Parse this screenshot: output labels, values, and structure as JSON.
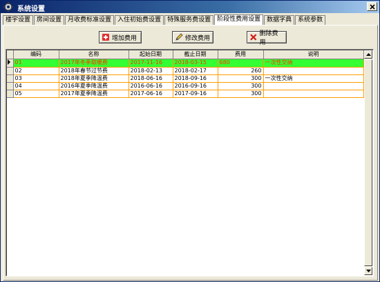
{
  "window": {
    "title": "系统设置"
  },
  "tabs": [
    {
      "label": "楼宇设置"
    },
    {
      "label": "房间设置"
    },
    {
      "label": "月收费标准设置"
    },
    {
      "label": "入住初始费设置"
    },
    {
      "label": "特殊服务费设置"
    },
    {
      "label": "阶段性费用设置"
    },
    {
      "label": "数据字典"
    },
    {
      "label": "系统参数"
    }
  ],
  "active_tab": "阶段性费用设置",
  "toolbar": {
    "add_label": "增加费用",
    "edit_label": "修改费用",
    "delete_label": "删除费用"
  },
  "table": {
    "columns": [
      "编码",
      "名称",
      "起始日期",
      "截止日期",
      "费用",
      "说明"
    ],
    "rows": [
      {
        "code": "01",
        "name": "2017年冬季取暖费",
        "start": "2017-11-16",
        "end": "2018-03-15",
        "fee": "680",
        "note": "一次性交纳",
        "selected": true
      },
      {
        "code": "02",
        "name": "2018年春节过节费",
        "start": "2018-02-13",
        "end": "2018-02-17",
        "fee": "260",
        "note": ""
      },
      {
        "code": "03",
        "name": "2018年夏季降温费",
        "start": "2018-06-16",
        "end": "2018-09-16",
        "fee": "300",
        "note": "一次性交纳"
      },
      {
        "code": "04",
        "name": "2016年夏季降温费",
        "start": "2016-06-16",
        "end": "2016-09-16",
        "fee": "300",
        "note": ""
      },
      {
        "code": "05",
        "name": "2017年夏季降温费",
        "start": "2017-06-16",
        "end": "2017-09-16",
        "fee": "300",
        "note": ""
      }
    ]
  },
  "colors": {
    "selected_row_bg": "#33ff33",
    "selected_row_text": "#ff3300",
    "grid_line": "#ff9c00",
    "title_bar": "#0a246a"
  },
  "icons": {
    "add": "plus-icon",
    "edit": "pencil-icon",
    "delete": "x-icon",
    "app": "gear-icon",
    "close": "close-icon"
  }
}
